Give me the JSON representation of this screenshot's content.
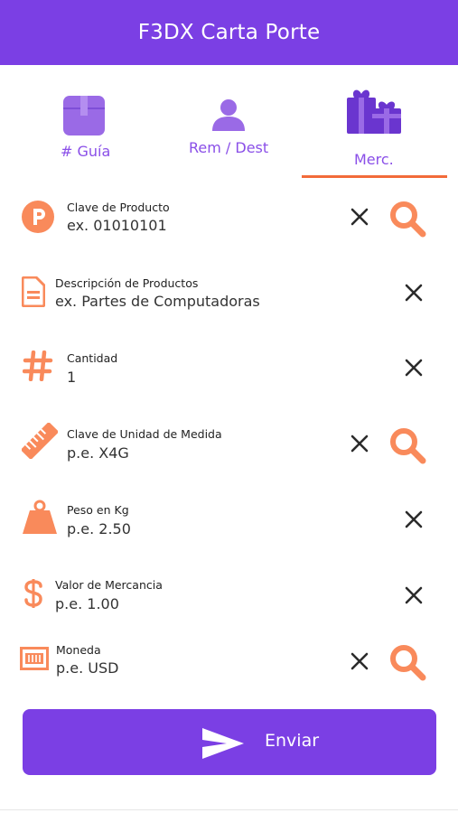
{
  "appbar": {
    "title": "F3DX Carta Porte"
  },
  "tabs": [
    {
      "label": "# Guía",
      "icon": "box-icon"
    },
    {
      "label": "Rem / Dest",
      "icon": "person-icon"
    },
    {
      "label": "Merc.",
      "icon": "gifts-icon",
      "selected": true
    }
  ],
  "fields": [
    {
      "label": "Clave de Producto",
      "value": "ex. 01010101",
      "icon": "parking-p-icon",
      "has_search": true
    },
    {
      "label": "Descripción de Productos",
      "value": "ex. Partes de Computadoras",
      "icon": "document-icon",
      "has_search": false
    },
    {
      "label": "Cantidad",
      "value": "1",
      "icon": "hash-icon",
      "has_search": false
    },
    {
      "label": "Clave de Unidad de Medida",
      "value": "p.e. X4G",
      "icon": "ruler-icon",
      "has_search": true
    },
    {
      "label": "Peso en Kg",
      "value": "p.e. 2.50",
      "icon": "weight-icon",
      "has_search": false
    },
    {
      "label": "Valor de Mercancia",
      "value": "p.e.  1.00",
      "icon": "dollar-icon",
      "has_search": false
    },
    {
      "label": "Moneda",
      "value": "p.e. USD",
      "icon": "banknote-icon",
      "has_search": true
    }
  ],
  "submit": {
    "label": "Enviar",
    "icon": "send-icon"
  },
  "colors": {
    "primary": "#7b3fe4",
    "accent": "#f98a5b",
    "indicator": "#f26b3a",
    "tab_text": "#8a4fe8"
  }
}
